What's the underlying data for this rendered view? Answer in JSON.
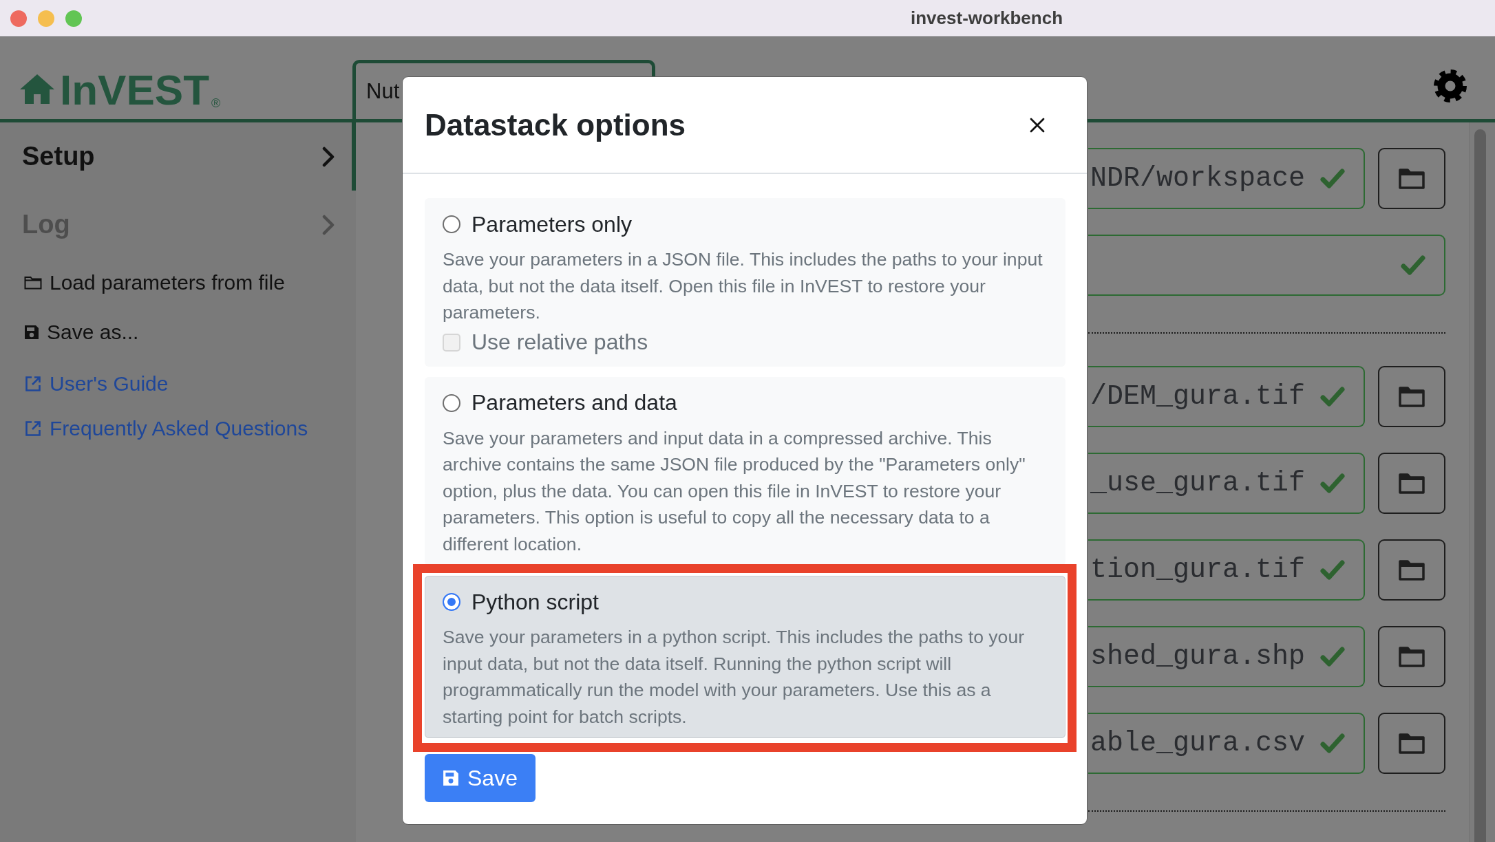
{
  "window": {
    "title": "invest-workbench"
  },
  "header": {
    "logo": "InVEST",
    "logo_mark": "®",
    "tabs": [
      {
        "label": "Nut",
        "selected": true
      }
    ]
  },
  "sidebar": {
    "nav": [
      {
        "label": "Setup",
        "selected": true
      },
      {
        "label": "Log",
        "selected": false
      }
    ],
    "actions": [
      {
        "kind": "open",
        "label": "Load parameters from file"
      },
      {
        "kind": "save",
        "label": "Save as..."
      }
    ],
    "links": [
      {
        "label": "User's Guide"
      },
      {
        "label": "Frequently Asked Questions"
      }
    ]
  },
  "form": {
    "groups": [
      {
        "fields": [
          {
            "kind": "path",
            "value": "NDR/workspace",
            "valid": true
          },
          {
            "kind": "text",
            "valid": true
          }
        ]
      },
      {
        "fields": [
          {
            "kind": "path",
            "value": "/DEM_gura.tif",
            "valid": true
          },
          {
            "kind": "path",
            "value": "_use_gura.tif",
            "valid": true
          },
          {
            "kind": "path",
            "value": "tion_gura.tif",
            "valid": true
          },
          {
            "kind": "path",
            "value": "shed_gura.shp",
            "valid": true
          },
          {
            "kind": "path",
            "value": "able_gura.csv",
            "valid": true
          }
        ]
      }
    ]
  },
  "modal": {
    "title": "Datastack options",
    "options": [
      {
        "label": "Parameters only",
        "description": "Save your parameters in a JSON file. This includes the paths to your input data, but not the data itself. Open this file in InVEST to restore your parameters.",
        "selected": false,
        "highlighted": false,
        "checkbox": {
          "label": "Use relative paths",
          "checked": false,
          "disabled": true
        }
      },
      {
        "label": "Parameters and data",
        "description": "Save your parameters and input data in a compressed archive. This archive contains the same JSON file produced by the \"Parameters only\" option, plus the data. You can open this file in InVEST to restore your parameters. This option is useful to copy all the necessary data to a different location.",
        "selected": false,
        "highlighted": false
      },
      {
        "label": "Python script",
        "description": "Save your parameters in a python script. This includes the paths to your input data, but not the data itself. Running the python script will programmatically run the model with your parameters. Use this as a starting point for batch scripts.",
        "selected": true,
        "highlighted": true
      }
    ],
    "save_button": {
      "label": "Save"
    }
  }
}
